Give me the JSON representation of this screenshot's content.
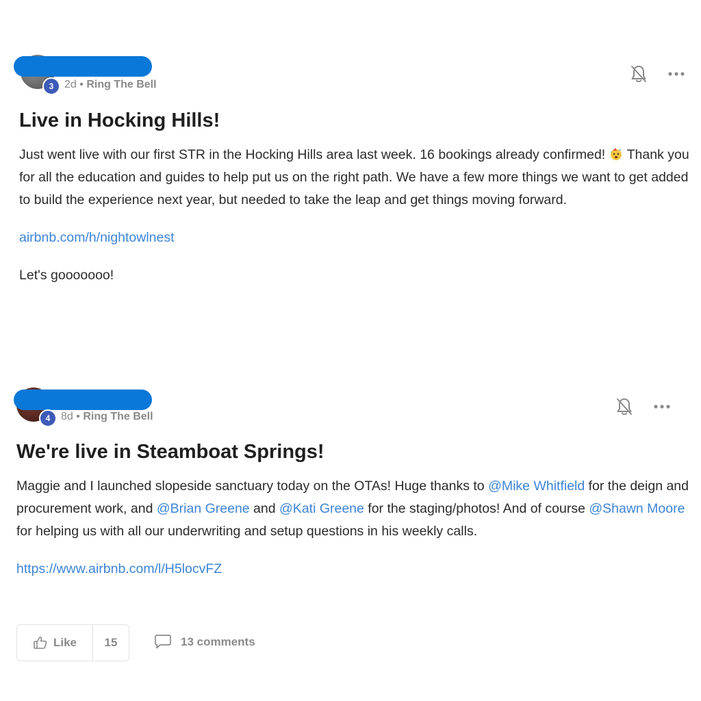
{
  "posts": [
    {
      "level": "3",
      "time": "2d",
      "separator": "•",
      "category": "Ring The Bell",
      "title": "Live in Hocking Hills!",
      "body": {
        "p1_before_emoji": "Just went live with our first STR in the Hocking Hills area last week. 16 bookings already confirmed!",
        "emoji_icon": "party-face-emoji-icon",
        "p1_after_emoji": "Thank you for all the education and guides to help put us on the right path. We have a few more things we want to get added to build the experience next year, but needed to take the leap and get things moving forward.",
        "link": "airbnb.com/h/nightowlnest",
        "closing": "Let's gooooooo!"
      },
      "icons": {
        "bell": "bell-off-icon",
        "more": "more-horizontal-icon"
      }
    },
    {
      "level": "4",
      "time": "8d",
      "separator": "•",
      "category": "Ring The Bell",
      "title": "We're live in Steamboat Springs!",
      "body": {
        "t1": "Maggie and I launched slopeside sanctuary today on the OTAs! Huge thanks to ",
        "m1": "@Mike Whitfield",
        "t2": " for the deign and procurement work, and ",
        "m2": "@Brian Greene",
        "t3": " and ",
        "m3": "@Kati Greene",
        "t4": " for the staging/photos! And of course ",
        "m4": "@Shawn Moore",
        "t5": " for helping us with all our underwriting and setup questions in his weekly calls.",
        "link": "https://www.airbnb.com/l/H5locvFZ"
      },
      "actions": {
        "like_label": "Like",
        "like_count": "15",
        "comments_label": "13 comments"
      },
      "icons": {
        "bell": "bell-off-icon",
        "more": "more-horizontal-icon",
        "like": "thumbs-up-icon",
        "comment": "comment-icon"
      }
    }
  ],
  "colors": {
    "accent_link": "#3d85d6",
    "redaction": "#0a78d8",
    "level_badge": "#3d5bb8",
    "meta_text": "#8a8a8a"
  }
}
